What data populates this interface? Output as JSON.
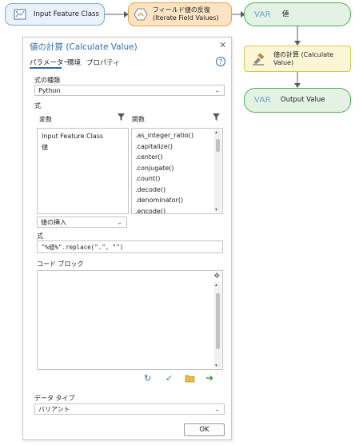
{
  "model": {
    "nodes": {
      "input_fc": "Input Feature Class",
      "iterate": "フィールド値の反復 (Iterate Field Values)",
      "value_var": "値",
      "calc": "値の計算 (Calculate Value)",
      "output": "Output Value",
      "var_tag": "VAR"
    }
  },
  "dialog": {
    "title": "値の計算 (Calculate Value)",
    "tabs": [
      "パラメーター",
      "環境",
      "プロパティ"
    ],
    "help_symbol": "?",
    "expr_type_label": "式の種類",
    "expr_type_value": "Python",
    "expr_section_label": "式",
    "variables_header": "変数",
    "functions_header": "関数",
    "variables": [
      "Input Feature Class",
      "値"
    ],
    "functions": [
      ".as_integer_ratio()",
      ".capitalize()",
      ".center()",
      ".conjugate()",
      ".count()",
      ".decode()",
      ".denominator()",
      ".encode()"
    ],
    "insert_value_label": "値の挿入",
    "expression_label": "式",
    "expression_value": "\"%値%\".replace(\".\", \"\")",
    "code_block_label": "コード ブロック",
    "code_block_value": "",
    "data_type_label": "データ タイプ",
    "data_type_value": "バリアント",
    "ok_label": "OK"
  },
  "colors": {
    "accent": "#2f6dab",
    "green_node": "#4caf50",
    "orange_node": "#e8a33d",
    "yellow_node": "#e8d97a",
    "var_blue": "#6c9fd6"
  }
}
